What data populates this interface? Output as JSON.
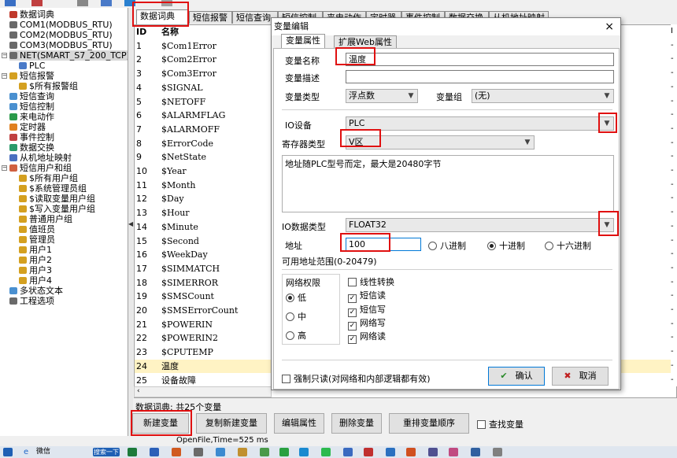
{
  "tree": {
    "items": [
      {
        "label": "数据词典",
        "level": 0
      },
      {
        "label": "COM1(MODBUS_RTU)",
        "level": 0
      },
      {
        "label": "COM2(MODBUS_RTU)",
        "level": 0
      },
      {
        "label": "COM3(MODBUS_RTU)",
        "level": 0
      },
      {
        "label": "NET(SMART_S7_200_TCP)",
        "level": 0
      },
      {
        "label": "PLC",
        "level": 1
      },
      {
        "label": "短信报警",
        "level": 0
      },
      {
        "label": "$所有报警组",
        "level": 1
      },
      {
        "label": "短信查询",
        "level": 0
      },
      {
        "label": "短信控制",
        "level": 0
      },
      {
        "label": "来电动作",
        "level": 0
      },
      {
        "label": "定时器",
        "level": 0
      },
      {
        "label": "事件控制",
        "level": 0
      },
      {
        "label": "数据交换",
        "level": 0
      },
      {
        "label": "从机地址映射",
        "level": 0
      },
      {
        "label": "短信用户和组",
        "level": 0
      },
      {
        "label": "$所有用户组",
        "level": 1
      },
      {
        "label": "$系统管理员组",
        "level": 1
      },
      {
        "label": "$读取变量用户组",
        "level": 1
      },
      {
        "label": "$写入变量用户组",
        "level": 1
      },
      {
        "label": "普通用户组",
        "level": 1
      },
      {
        "label": "值班员",
        "level": 1
      },
      {
        "label": "管理员",
        "level": 1
      },
      {
        "label": "用户1",
        "level": 1
      },
      {
        "label": "用户2",
        "level": 1
      },
      {
        "label": "用户3",
        "level": 1
      },
      {
        "label": "用户4",
        "level": 1
      },
      {
        "label": "多状态文本",
        "level": 0
      },
      {
        "label": "工程选项",
        "level": 0
      }
    ]
  },
  "tabs": [
    "数据词典",
    "短信报警",
    "短信查询",
    "短信控制",
    "来电动作",
    "定时器",
    "事件控制",
    "数据交换",
    "从机地址映射"
  ],
  "grid": {
    "headers": {
      "id": "ID",
      "name": "名称"
    },
    "rows": [
      {
        "id": "1",
        "name": "$Com1Error"
      },
      {
        "id": "2",
        "name": "$Com2Error"
      },
      {
        "id": "3",
        "name": "$Com3Error"
      },
      {
        "id": "4",
        "name": "$SIGNAL"
      },
      {
        "id": "5",
        "name": "$NETOFF"
      },
      {
        "id": "6",
        "name": "$ALARMFLAG"
      },
      {
        "id": "7",
        "name": "$ALARMOFF"
      },
      {
        "id": "8",
        "name": "$ErrorCode"
      },
      {
        "id": "9",
        "name": "$NetState"
      },
      {
        "id": "10",
        "name": "$Year"
      },
      {
        "id": "11",
        "name": "$Month"
      },
      {
        "id": "12",
        "name": "$Day"
      },
      {
        "id": "13",
        "name": "$Hour"
      },
      {
        "id": "14",
        "name": "$Minute"
      },
      {
        "id": "15",
        "name": "$Second"
      },
      {
        "id": "16",
        "name": "$WeekDay"
      },
      {
        "id": "17",
        "name": "$SIMMATCH"
      },
      {
        "id": "18",
        "name": "$SIMERROR"
      },
      {
        "id": "19",
        "name": "$SMSCount"
      },
      {
        "id": "20",
        "name": "$SMSErrorCount"
      },
      {
        "id": "21",
        "name": "$POWERIN"
      },
      {
        "id": "22",
        "name": "$POWERIN2"
      },
      {
        "id": "23",
        "name": "$CPUTEMP"
      },
      {
        "id": "24",
        "name": "温度"
      },
      {
        "id": "25",
        "name": "设备故障"
      }
    ],
    "right_col_label": "I"
  },
  "summary": "数据词典: 共25个变量",
  "buttons": {
    "new": "新建变量",
    "copy_new": "复制新建变量",
    "edit": "编辑属性",
    "delete": "删除变量",
    "reorder": "重排变量顺序",
    "lookup": "查找变量"
  },
  "status": "OpenFile,Time=525 ms",
  "taskbar": {
    "e_label": "e",
    "app_text": "微信",
    "search": "搜索一下"
  },
  "dialog": {
    "title": "变量编辑",
    "close": "×",
    "tabs": [
      "变量属性",
      "扩展Web属性"
    ],
    "var_name_label": "变量名称",
    "var_name_value": "温度",
    "var_desc_label": "变量描述",
    "var_desc_value": "",
    "var_type_label": "变量类型",
    "var_type_value": "浮点数",
    "var_group_label": "变量组",
    "var_group_value": "(无)",
    "io_device_label": "IO设备",
    "io_device_value": "PLC",
    "reg_type_label": "寄存器类型",
    "reg_type_value": "V区",
    "note": "地址随PLC型号而定，最大是20480字节",
    "io_data_type_label": "IO数据类型",
    "io_data_type_value": "FLOAT32",
    "address_label": "地址",
    "address_value": "100",
    "radix_options": [
      "八进制",
      "十进制",
      "十六进制"
    ],
    "radix_selected": "十进制",
    "range_text": "可用地址范围(0-20479)",
    "perm_title": "网络权限",
    "perm_options": [
      "低",
      "中",
      "高"
    ],
    "perm_selected": "低",
    "checks": [
      {
        "label": "线性转换",
        "checked": false
      },
      {
        "label": "短信读",
        "checked": true
      },
      {
        "label": "短信写",
        "checked": true
      },
      {
        "label": "网络写",
        "checked": true
      },
      {
        "label": "网络读",
        "checked": true
      }
    ],
    "force_readonly": "强制只读(对网络和内部逻辑都有效)",
    "ok": "确认",
    "cancel": "取消"
  },
  "colors": {
    "highlight_row": "#fff3c4",
    "annotation_red": "#e01010",
    "accent": "#0078d7"
  }
}
